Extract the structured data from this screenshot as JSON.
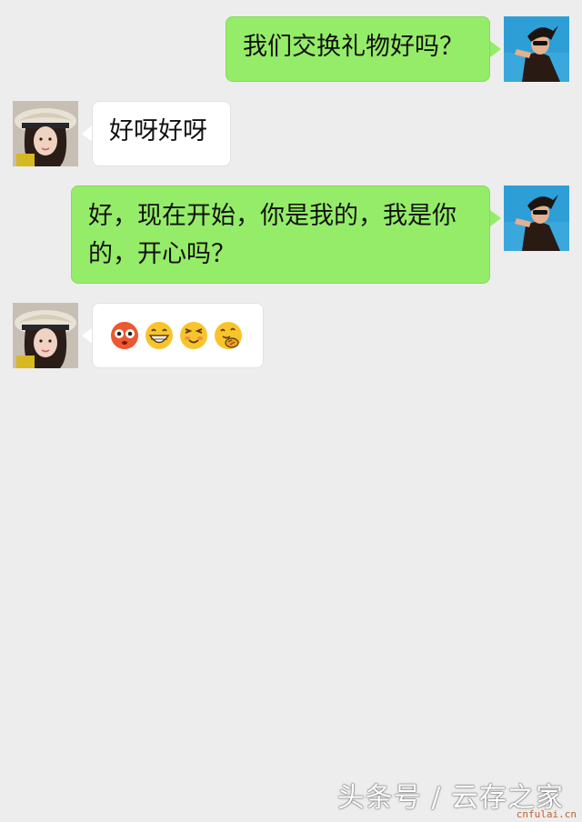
{
  "messages": [
    {
      "side": "out",
      "text": "我们交换礼物好吗？"
    },
    {
      "side": "in",
      "text": "好呀好呀"
    },
    {
      "side": "out",
      "text": "好，现在开始，你是我的，我是你的，开心吗？"
    },
    {
      "side": "in",
      "emojis": [
        "flushed-emoji",
        "grin-emoji",
        "smile-emoji",
        "hug-emoji"
      ]
    }
  ],
  "watermark": {
    "text": "头条号 / 云存之家",
    "site": "cnfulai.cn"
  },
  "colors": {
    "background": "#ededed",
    "outgoing_bubble": "#95ec69",
    "incoming_bubble": "#ffffff"
  }
}
